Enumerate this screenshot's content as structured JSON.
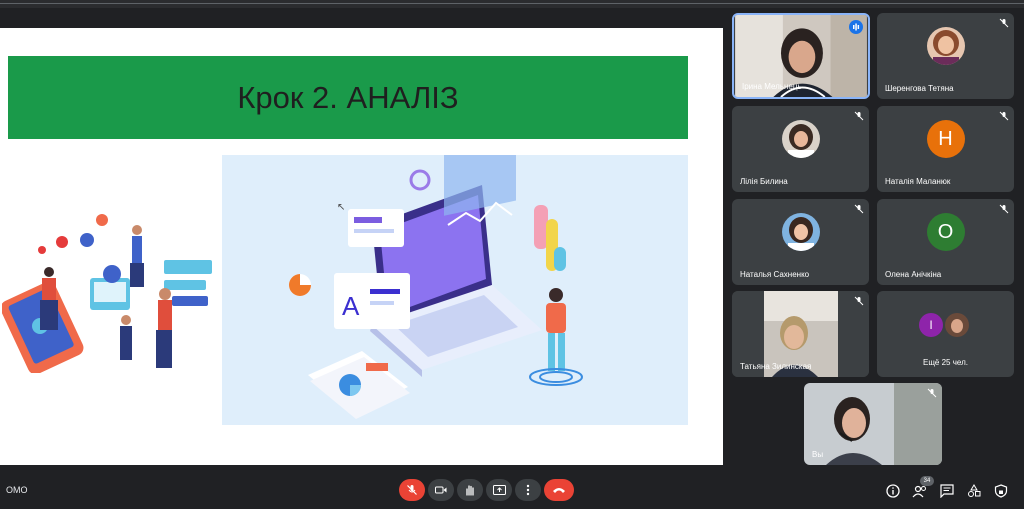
{
  "slide": {
    "title": "Крок 2. АНАЛІЗ"
  },
  "participants": [
    {
      "name": "Ірина Мельнець",
      "type": "video",
      "speaking": true
    },
    {
      "name": "Шеренгова Тетяна",
      "type": "photo",
      "muted": true
    },
    {
      "name": "Лілія Билина",
      "type": "photo",
      "muted": true
    },
    {
      "name": "Наталія Маланюк",
      "type": "letter",
      "letter": "Н",
      "color": "#e8710a",
      "muted": true
    },
    {
      "name": "Наталья Сахненко",
      "type": "photo",
      "muted": true
    },
    {
      "name": "Олена Анічкіна",
      "type": "letter",
      "letter": "О",
      "color": "#2e7d32",
      "muted": true
    },
    {
      "name": "Татьяна Зилинская",
      "type": "video",
      "muted": true
    },
    {
      "name": "",
      "type": "more",
      "letter": "І",
      "color": "#8e24aa"
    }
  ],
  "more": {
    "label": "Ещё 25 чел."
  },
  "self_view": {
    "name": "Вы"
  },
  "bottom": {
    "meeting_code": "ОМО",
    "participant_count": "34"
  },
  "colors": {
    "title_bar": "#1a9a4a",
    "end_call": "#ea4335",
    "mic_off": "#ea4335",
    "speaking": "#1a73e8"
  }
}
